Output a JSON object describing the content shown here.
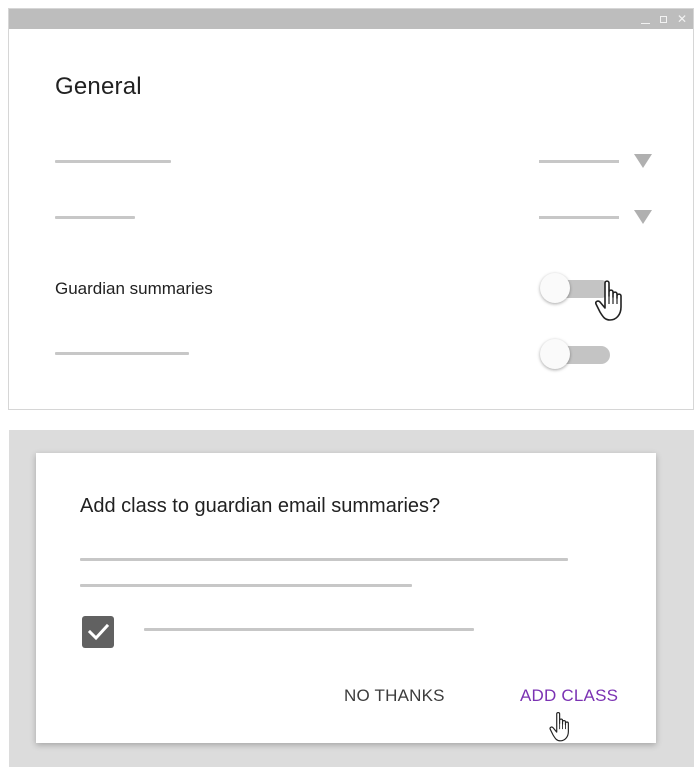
{
  "window": {
    "controls": {
      "minimize": "minimize-icon",
      "maximize": "maximize-icon",
      "close": "close-icon"
    }
  },
  "settings": {
    "section_title": "General",
    "guardian_summaries_label": "Guardian summaries",
    "guardian_toggle_icon": "hand-pointer-icon"
  },
  "dialog": {
    "title": "Add class to guardian email summaries?",
    "checkbox_checked": true,
    "no_thanks_label": "NO THANKS",
    "add_class_label": "ADD CLASS"
  },
  "colors": {
    "accent": "#7b32b3",
    "titlebar": "#bdbdbd",
    "placeholder": "#c7c7c7",
    "checkbox": "#616161"
  }
}
